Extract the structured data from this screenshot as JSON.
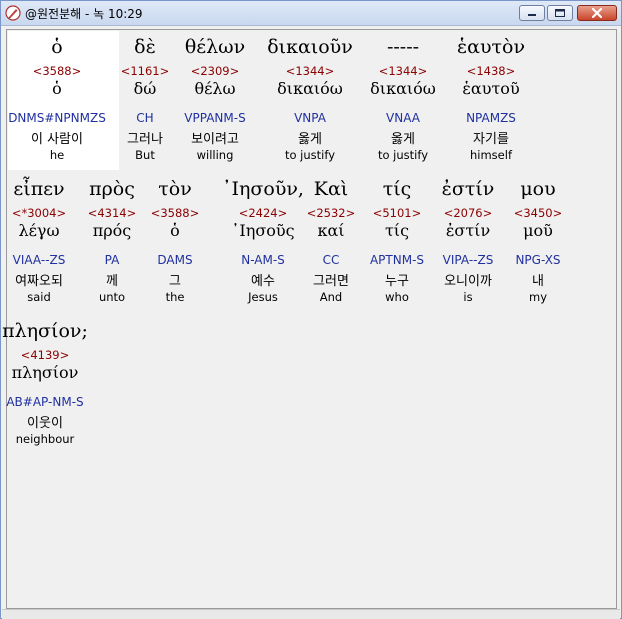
{
  "window": {
    "title": "@원전분해 - 녹 10:29",
    "icon": "pen-nib-icon",
    "buttons": {
      "minimize": "minimize-icon",
      "maximize": "maximize-icon",
      "close": "close-icon"
    }
  },
  "rows": [
    {
      "words": [
        {
          "greek": "ὁ",
          "strongs": "<3588>",
          "lemma": "ὁ",
          "morph": "DNMS#NPNMZS",
          "kor": "이 사람이",
          "eng": "he"
        },
        {
          "greek": "δὲ",
          "strongs": "<1161>",
          "lemma": "δώ",
          "morph": "CH",
          "kor": "그러나",
          "eng": "But"
        },
        {
          "greek": "θέλων",
          "strongs": "<2309>",
          "lemma": "θέλω",
          "morph": "VPPANM-S",
          "kor": "보이려고",
          "eng": "willing"
        },
        {
          "greek": "δικαιοῦν",
          "strongs": "<1344>",
          "lemma": "δικαιόω",
          "morph": "VNPA",
          "kor": "옳게",
          "eng": "to justify"
        },
        {
          "greek": "-----",
          "strongs": "<1344>",
          "lemma": "δικαιόω",
          "morph": "VNAA",
          "kor": "옳게",
          "eng": "to justify"
        },
        {
          "greek": "ἑαυτὸν",
          "strongs": "<1438>",
          "lemma": "ἑαυτοῦ",
          "morph": "NPAMZS",
          "kor": "자기를",
          "eng": "himself"
        }
      ]
    },
    {
      "words": [
        {
          "greek": "εἶπεν",
          "strongs": "<*3004>",
          "lemma": "λέγω",
          "morph": "VIAA--ZS",
          "kor": "여짜오되",
          "eng": "said"
        },
        {
          "greek": "πρὸς",
          "strongs": "<4314>",
          "lemma": "πρός",
          "morph": "PA",
          "kor": "께",
          "eng": "unto"
        },
        {
          "greek": "τὸν",
          "strongs": "<3588>",
          "lemma": "ὁ",
          "morph": "DAMS",
          "kor": "그",
          "eng": "the"
        },
        {
          "greek": "᾿Ιησοῦν,",
          "strongs": "<2424>",
          "lemma": "᾿Ιησοῦς",
          "morph": "N-AM-S",
          "kor": "예수",
          "eng": "Jesus"
        },
        {
          "greek": "Καὶ",
          "strongs": "<2532>",
          "lemma": "καί",
          "morph": "CC",
          "kor": "그러면",
          "eng": "And"
        },
        {
          "greek": "τίς",
          "strongs": "<5101>",
          "lemma": "τίς",
          "morph": "APTNM-S",
          "kor": "누구",
          "eng": "who"
        },
        {
          "greek": "ἐστίν",
          "strongs": "<2076>",
          "lemma": "ἐστίν",
          "morph": "VIPA--ZS",
          "kor": "오니이까",
          "eng": "is"
        },
        {
          "greek": "μου",
          "strongs": "<3450>",
          "lemma": "μοῦ",
          "morph": "NPG-XS",
          "kor": "내",
          "eng": "my"
        }
      ]
    },
    {
      "words": [
        {
          "greek": "πλησίον;",
          "strongs": "<4139>",
          "lemma": "πλησίον",
          "morph": "AB#AP-NM-S",
          "kor": "이웃이",
          "eng": "neighbour"
        }
      ]
    }
  ]
}
